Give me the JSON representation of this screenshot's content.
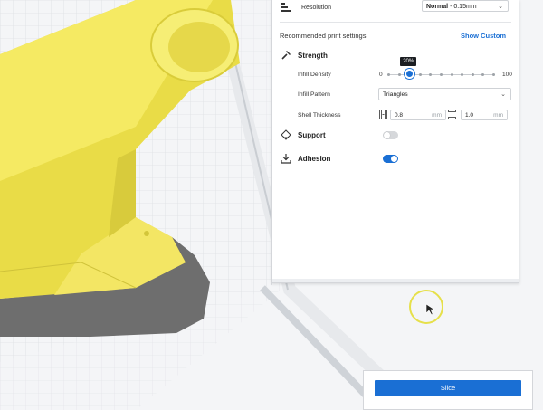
{
  "resolution": {
    "label": "Resolution",
    "value_bold": "Normal",
    "value_rest": " - 0.15mm"
  },
  "recommended": {
    "title": "Recommended print settings",
    "show_custom": "Show Custom"
  },
  "strength": {
    "title": "Strength",
    "infill_density": {
      "label": "Infill Density",
      "min": "0",
      "max": "100",
      "value": 20,
      "tooltip": "20%"
    },
    "infill_pattern": {
      "label": "Infill Pattern",
      "value": "Triangles"
    },
    "shell_thickness": {
      "label": "Shell Thickness",
      "wall": "0.8",
      "top_bottom": "1.0",
      "unit": "mm"
    }
  },
  "support": {
    "label": "Support",
    "enabled": false
  },
  "adhesion": {
    "label": "Adhesion",
    "enabled": true
  },
  "slice": {
    "label": "Slice"
  },
  "colors": {
    "accent": "#1a6fd4",
    "model": "#f2e86a",
    "cursor_ring": "#e6e04a"
  }
}
